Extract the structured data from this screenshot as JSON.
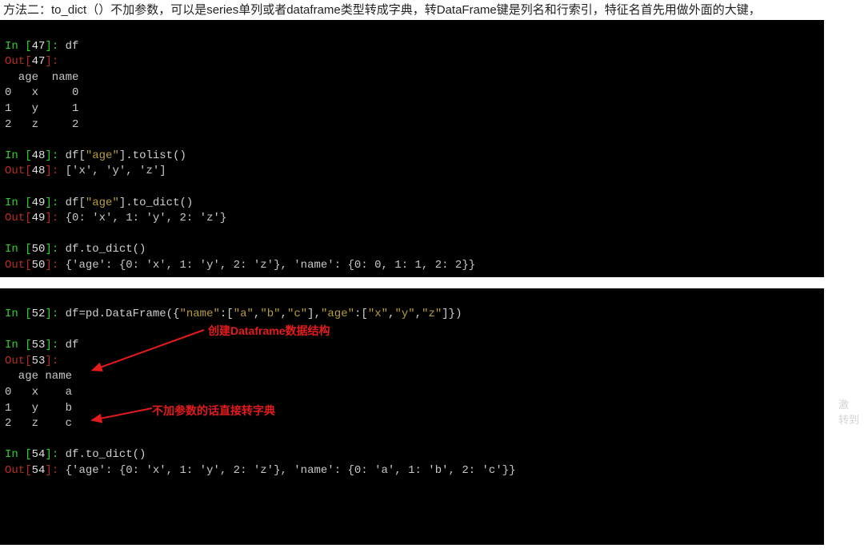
{
  "description": "方法二：to_dict（）不加参数，可以是series单列或者dataframe类型转成字典，转DataFrame键是列名和行索引，特征名首先用做外面的大键，",
  "term1": {
    "l1_in": "In [",
    "l1_num": "47",
    "l1_in2": "]:",
    "l1_code": " df",
    "l2_out": "Out[",
    "l2_num": "47",
    "l2_out2": "]:",
    "tbl_hdr": "  age  name",
    "tbl_r0": "0   x     0",
    "tbl_r1": "1   y     1",
    "tbl_r2": "2   z     2",
    "l3_in": "In [",
    "l3_num": "48",
    "l3_in2": "]:",
    "l3_code": " df[",
    "l3_str": "\"age\"",
    "l3_code2": "].tolist()",
    "l4_out": "Out[",
    "l4_num": "48",
    "l4_out2": "]:",
    "l4_res": " ['x', 'y', 'z']",
    "l5_in": "In [",
    "l5_num": "49",
    "l5_in2": "]:",
    "l5_code": " df[",
    "l5_str": "\"age\"",
    "l5_code2": "].to_dict()",
    "l6_out": "Out[",
    "l6_num": "49",
    "l6_out2": "]:",
    "l6_res": " {0: 'x', 1: 'y', 2: 'z'}",
    "l7_in": "In [",
    "l7_num": "50",
    "l7_in2": "]:",
    "l7_code": " df.to_dict()",
    "l8_out": "Out[",
    "l8_num": "50",
    "l8_out2": "]:",
    "l8_res": " {'age': {0: 'x', 1: 'y', 2: 'z'}, 'name': {0: 0, 1: 1, 2: 2}}"
  },
  "term2": {
    "l1_in": "In [",
    "l1_num": "52",
    "l1_in2": "]:",
    "l1_code": " df=pd.DataFrame({",
    "l1_s1": "\"name\"",
    "l1_c1": ":[",
    "l1_s2": "\"a\"",
    "l1_c2": ",",
    "l1_s3": "\"b\"",
    "l1_c3": ",",
    "l1_s4": "\"c\"",
    "l1_c4": "],",
    "l1_s5": "\"age\"",
    "l1_c5": ":[",
    "l1_s6": "\"x\"",
    "l1_c6": ",",
    "l1_s7": "\"y\"",
    "l1_c7": ",",
    "l1_s8": "\"z\"",
    "l1_c8": "]})",
    "l2_in": "In [",
    "l2_num": "53",
    "l2_in2": "]:",
    "l2_code": " df",
    "l3_out": "Out[",
    "l3_num": "53",
    "l3_out2": "]:",
    "tbl_hdr": "  age name",
    "tbl_r0": "0   x    a",
    "tbl_r1": "1   y    b",
    "tbl_r2": "2   z    c",
    "l4_in": "In [",
    "l4_num": "54",
    "l4_in2": "]:",
    "l4_code": " df.to_dict()",
    "l5_out": "Out[",
    "l5_num": "54",
    "l5_out2": "]:",
    "l5_res": " {'age': {0: 'x', 1: 'y', 2: 'z'}, 'name': {0: 'a', 1: 'b', 2: 'c'}}",
    "anno1": "创建Dataframe数据结构",
    "anno2": "不加参数的话直接转字典"
  },
  "watermark": {
    "l1": "激",
    "l2": "转到"
  }
}
